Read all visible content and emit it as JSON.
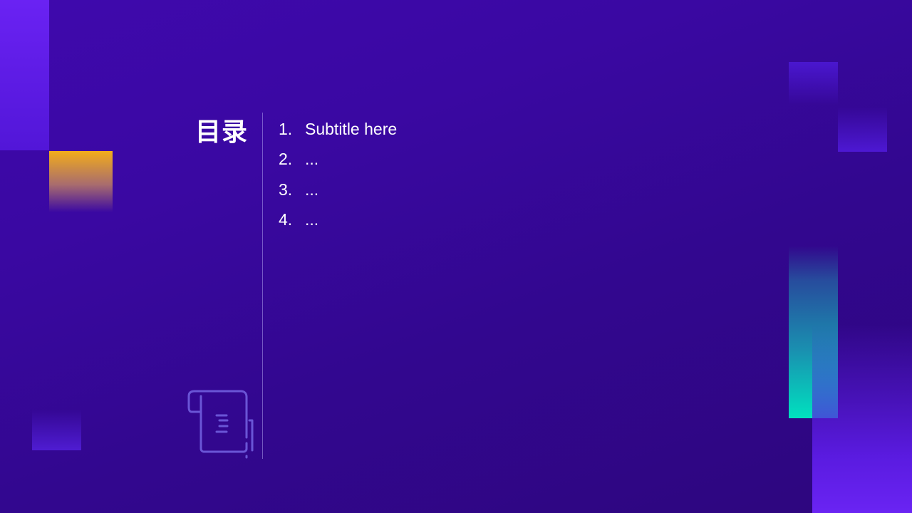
{
  "slide": {
    "title": "目录",
    "items": [
      {
        "number": "1.",
        "label": "Subtitle here"
      },
      {
        "number": "2.",
        "label": "..."
      },
      {
        "number": "3.",
        "label": "..."
      },
      {
        "number": "4.",
        "label": "..."
      }
    ],
    "icon": "document-scroll-icon"
  },
  "colors": {
    "background": "#3a08a2",
    "accent_orange": "#f3ad1b",
    "accent_teal": "#00e1bf",
    "accent_violet": "#6a22f3",
    "text": "#ffffff"
  }
}
